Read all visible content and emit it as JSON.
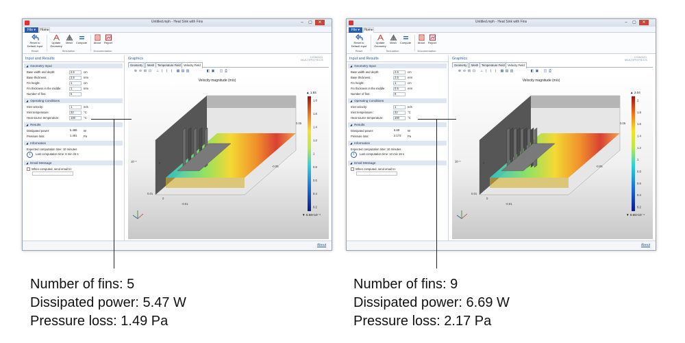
{
  "window": {
    "title": "Untitled.mph - Heat Sink with Fins",
    "minimize": "–",
    "maximize": "▢",
    "close": "✕"
  },
  "ribbon": {
    "file_tab": "File ▾",
    "home_tab": "Home",
    "reset_label": "Reset to Default Input",
    "reset_group": "Reset",
    "update_geometry_label": "Update Geometry",
    "mesh_label": "Mesh",
    "compute_label": "Compute",
    "simulation_group": "Simulation",
    "about_label": "About",
    "report_label": "Report",
    "documentation_group": "Documentation"
  },
  "panel": {
    "title": "Input and Results",
    "geometry_header": "Geometry Input",
    "base_width_label": "Base width and depth:",
    "base_thickness_label": "Base thickness:",
    "fin_height_label": "Fin height:",
    "fin_thickness_label": "Fin thickness in the middle:",
    "number_of_fins_label": "Number of fins:",
    "operating_header": "Operating Conditions",
    "inlet_velocity_label": "Inlet velocity:",
    "inlet_temperature_label": "Inlet temperature:",
    "heat_source_label": "Heat source temperature:",
    "results_header": "Results",
    "dissipated_power_label": "Dissipated power:",
    "pressure_loss_label": "Pressure loss:",
    "information_header": "Information",
    "expected_time": "Expected computation time: 10 minutes",
    "email_header": "Email Message",
    "email_checkbox_label": "When computed, send email to:"
  },
  "units": {
    "cm": "cm",
    "mm": "mm",
    "ms": "m/s",
    "degc": "°C",
    "w": "W",
    "pa": "Pa"
  },
  "graphics": {
    "title": "Graphics",
    "logo_line1": "COMSOL",
    "logo_line2": "MULTIPHYSICS",
    "tabs": [
      "Geometry",
      "Mesh",
      "Temperature Field",
      "Velocity Field"
    ],
    "plot_title": "Velocity magnitude (m/s)",
    "axis_ticks": [
      "0.05",
      "0.01",
      "0",
      "-0.01",
      "0",
      "-0.05"
    ],
    "axis_exp": "10⁻²",
    "about_link": "About"
  },
  "left_case": {
    "inputs": {
      "base_width": "2.5",
      "base_thickness": "2.5",
      "fin_height": "1",
      "fin_thickness": "1",
      "number_of_fins": "5",
      "inlet_velocity": "1",
      "inlet_temperature": "22",
      "heat_source_temperature": "100"
    },
    "results": {
      "dissipated_power": "5.466",
      "pressure_loss": "1.491"
    },
    "last_computation": "Last computation time: 8 min 23 s",
    "colorbar": {
      "max_label": "▲ 1.84",
      "min_label": "▼ 5.56×10⁻⁴",
      "ticks": [
        "1.8",
        "1.6",
        "1.4",
        "1.2",
        "1",
        "0.8",
        "0.6",
        "0.4",
        "0.2"
      ]
    },
    "caption": [
      "Number of fins: 5",
      "Dissipated power: 5.47 W",
      "Pressure loss: 1.49 Pa"
    ]
  },
  "right_case": {
    "inputs": {
      "base_width": "2.5",
      "base_thickness": "2.5",
      "fin_height": "1",
      "fin_thickness": "0.5",
      "number_of_fins": "9",
      "inlet_velocity": "1",
      "inlet_temperature": "22",
      "heat_source_temperature": "100"
    },
    "results": {
      "dissipated_power": "6.69",
      "pressure_loss": "2.173"
    },
    "last_computation": "Last computation time: 10 min 19 s",
    "colorbar": {
      "max_label": "▲ 2.04",
      "min_label": "▼ 8.65×10⁻⁴",
      "ticks": [
        "2",
        "1.8",
        "1.6",
        "1.4",
        "1.2",
        "1",
        "0.8",
        "0.6",
        "0.4",
        "0.2"
      ]
    },
    "caption": [
      "Number of fins: 9",
      "Dissipated power: 6.69 W",
      "Pressure loss: 2.17 Pa"
    ]
  },
  "colors": {
    "accent": "#2a5ca8",
    "section_bg": "#dde6f1",
    "metal_dark": "#3a3a3a",
    "metal_light": "#d8d8d8"
  }
}
